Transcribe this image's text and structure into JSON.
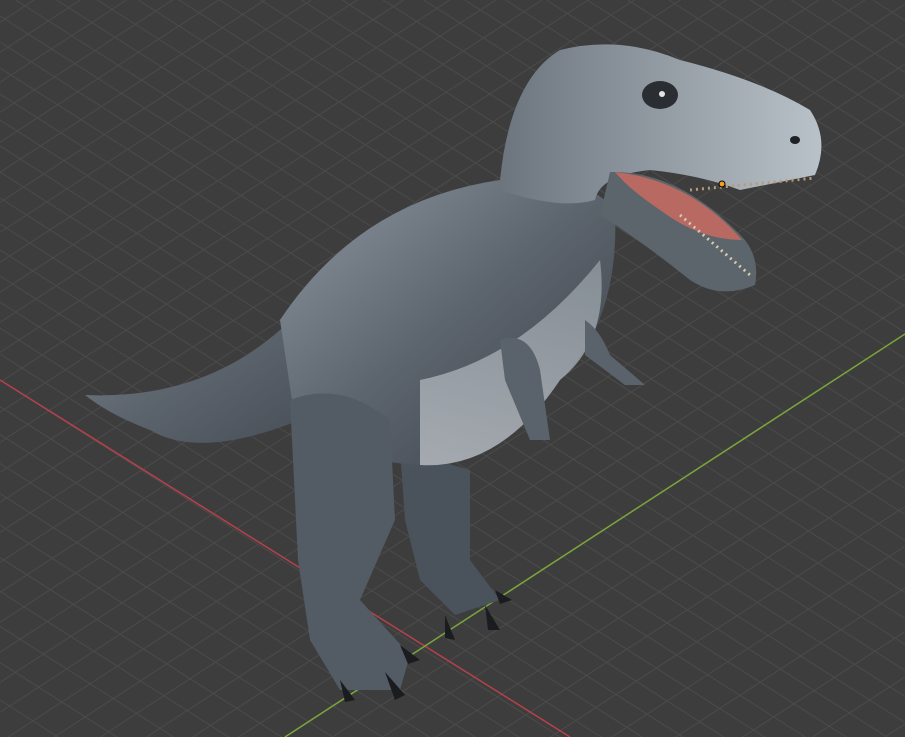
{
  "viewport": {
    "background": "#3d3d3d",
    "grid_color": "#4b4b4b",
    "axis_x_color": "#b8404a",
    "axis_y_color": "#7aa63a",
    "object_name": "dinosaur-model",
    "origin_color": "#f0a020"
  }
}
